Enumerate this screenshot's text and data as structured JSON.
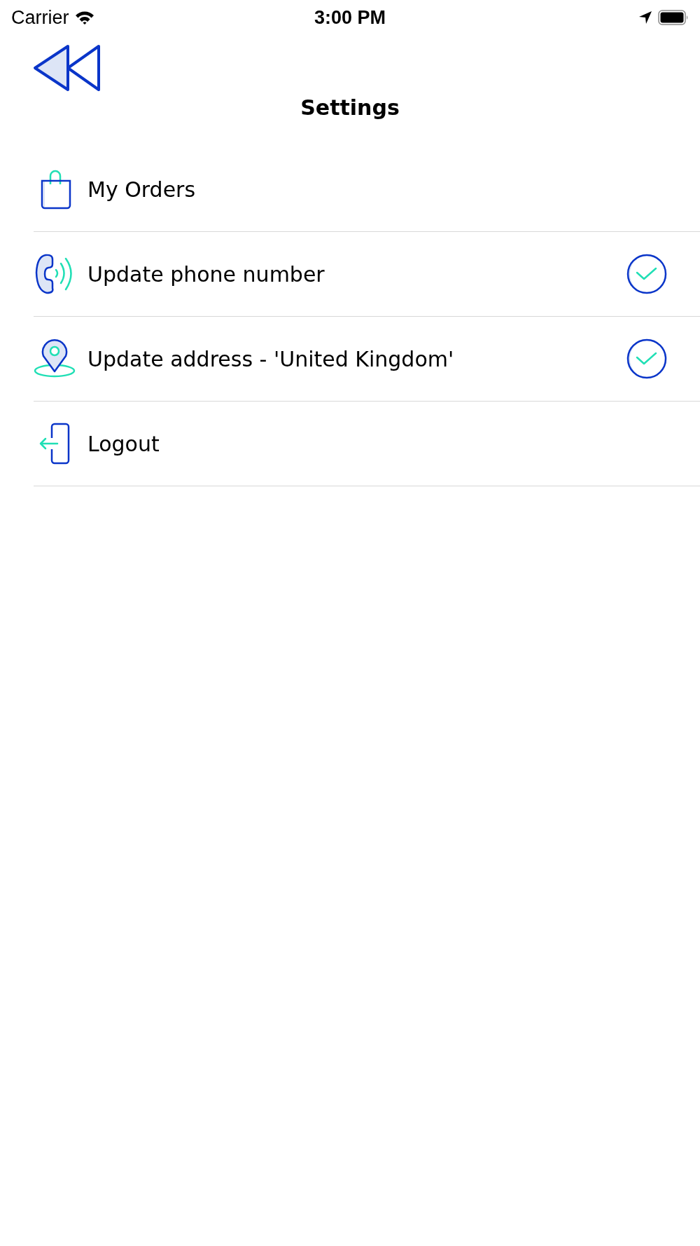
{
  "status_bar": {
    "carrier": "Carrier",
    "time": "3:00 PM"
  },
  "title": "Settings",
  "items": [
    {
      "kind": "orders",
      "label": "My Orders",
      "checked": false
    },
    {
      "kind": "phone",
      "label": "Update phone number",
      "checked": true
    },
    {
      "kind": "address",
      "label": "Update address - 'United Kingdom'",
      "checked": true
    },
    {
      "kind": "logout",
      "label": "Logout",
      "checked": false
    }
  ]
}
